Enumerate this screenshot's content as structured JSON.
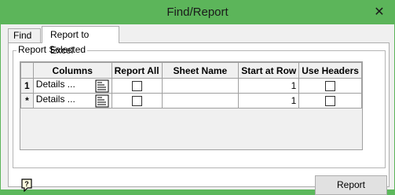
{
  "window": {
    "title": "Find/Report",
    "close_glyph": "✕"
  },
  "tabs": [
    {
      "label": "Find",
      "active": false
    },
    {
      "label": "Report to Excel",
      "active": true
    }
  ],
  "group": {
    "label": "Report Selected"
  },
  "grid": {
    "headers": [
      "",
      "Columns",
      "Report All",
      "Sheet Name",
      "Start at Row",
      "Use Headers"
    ],
    "rows": [
      {
        "row_header": "1",
        "columns": "Details ...",
        "report_all": false,
        "sheet_name": "",
        "start_at_row": "1",
        "use_headers": false
      },
      {
        "row_header": "*",
        "columns": "Details ...",
        "report_all": false,
        "sheet_name": "",
        "start_at_row": "1",
        "use_headers": false
      }
    ]
  },
  "footer": {
    "report_label": "Report",
    "help_icon": "help-icon"
  },
  "colors": {
    "titlebar": "#5cb55a",
    "client": "#f0f0f0",
    "panel": "#ffffff"
  }
}
